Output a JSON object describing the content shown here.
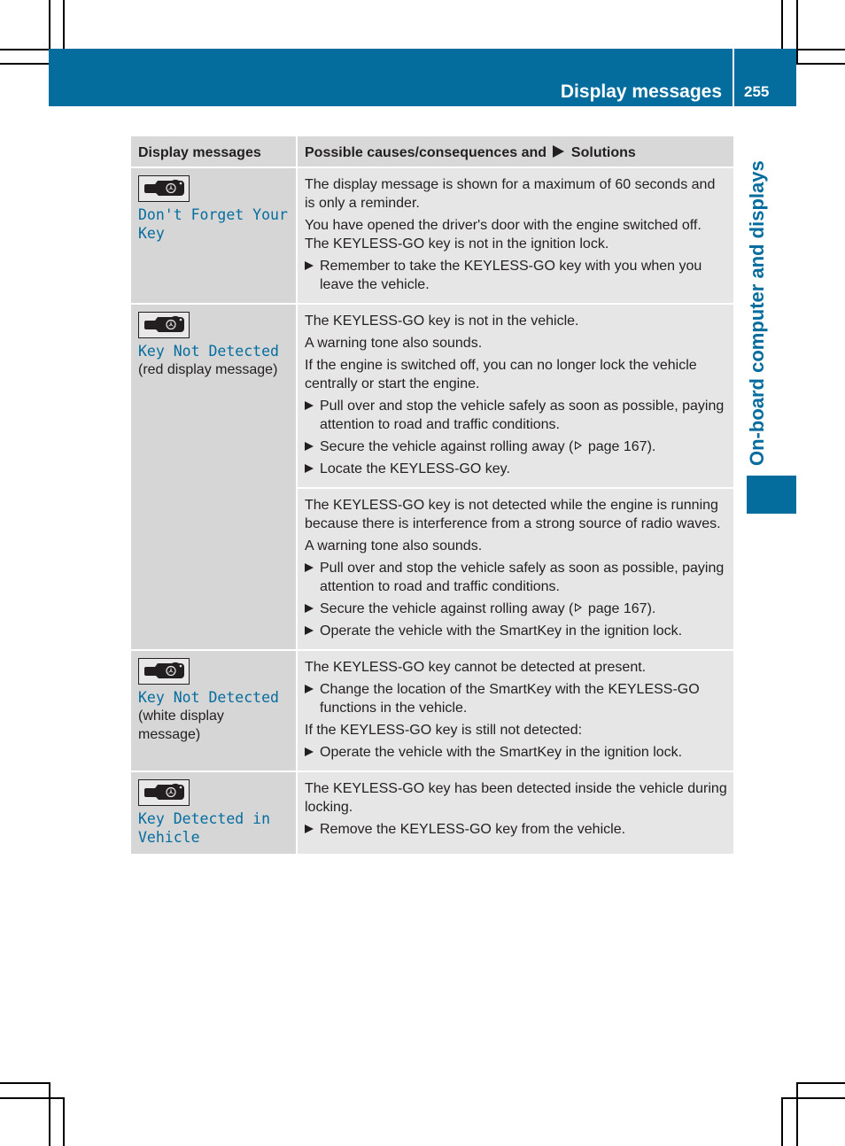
{
  "header": {
    "section_title": "Display messages",
    "page_number": "255"
  },
  "side_tab": {
    "label": "On-board computer and displays"
  },
  "colors": {
    "brand_blue": "#046d9e",
    "cell_left": "#d6d6d6",
    "cell_right": "#e6e6e6"
  },
  "table": {
    "col1_header": "Display messages",
    "col2_header_a": "Possible causes/consequences and",
    "col2_header_b": "Solutions",
    "rows": [
      {
        "icon": "keyless-go-key-icon",
        "message": "Don't Forget Your Key",
        "note": "",
        "blocks": [
          {
            "paras": [
              "The display message is shown for a maximum of 60 seconds and is only a reminder.",
              "You have opened the driver's door with the engine switched off. The KEYLESS-GO key is not in the ignition lock."
            ],
            "steps": [
              "Remember to take the KEYLESS-GO key with you when you leave the vehicle."
            ]
          }
        ]
      },
      {
        "icon": "keyless-go-key-icon",
        "message": "Key Not Detected",
        "note": "(red display message)",
        "blocks": [
          {
            "paras": [
              "The KEYLESS-GO key is not in the vehicle.",
              "A warning tone also sounds.",
              "If the engine is switched off, you can no longer lock the vehicle centrally or start the engine."
            ],
            "steps": [
              "Pull over and stop the vehicle safely as soon as possible, paying attention to road and traffic conditions.",
              "Secure the vehicle against rolling away (",
              "Locate the KEYLESS-GO key."
            ],
            "page_ref": "page 167)."
          },
          {
            "paras": [
              "The KEYLESS-GO key is not detected while the engine is running because there is interference from a strong source of radio waves.",
              "A warning tone also sounds."
            ],
            "steps": [
              "Pull over and stop the vehicle safely as soon as possible, paying attention to road and traffic conditions.",
              "Secure the vehicle against rolling away (",
              "Operate the vehicle with the SmartKey in the ignition lock."
            ],
            "page_ref": "page 167)."
          }
        ]
      },
      {
        "icon": "keyless-go-key-icon",
        "message": "Key Not Detected",
        "note": "(white display message)",
        "blocks": [
          {
            "paras": [
              "The KEYLESS-GO key cannot be detected at present."
            ],
            "steps": [
              "Change the location of the SmartKey with the KEYLESS-GO functions in the vehicle."
            ],
            "paras2": [
              "If the KEYLESS-GO key is still not detected:"
            ],
            "steps2": [
              "Operate the vehicle with the SmartKey in the ignition lock."
            ]
          }
        ]
      },
      {
        "icon": "keyless-go-key-icon",
        "message": "Key Detected in Vehicle",
        "note": "",
        "blocks": [
          {
            "paras": [
              "The KEYLESS-GO key has been detected inside the vehicle during locking."
            ],
            "steps": [
              "Remove the KEYLESS-GO key from the vehicle."
            ]
          }
        ]
      }
    ]
  }
}
